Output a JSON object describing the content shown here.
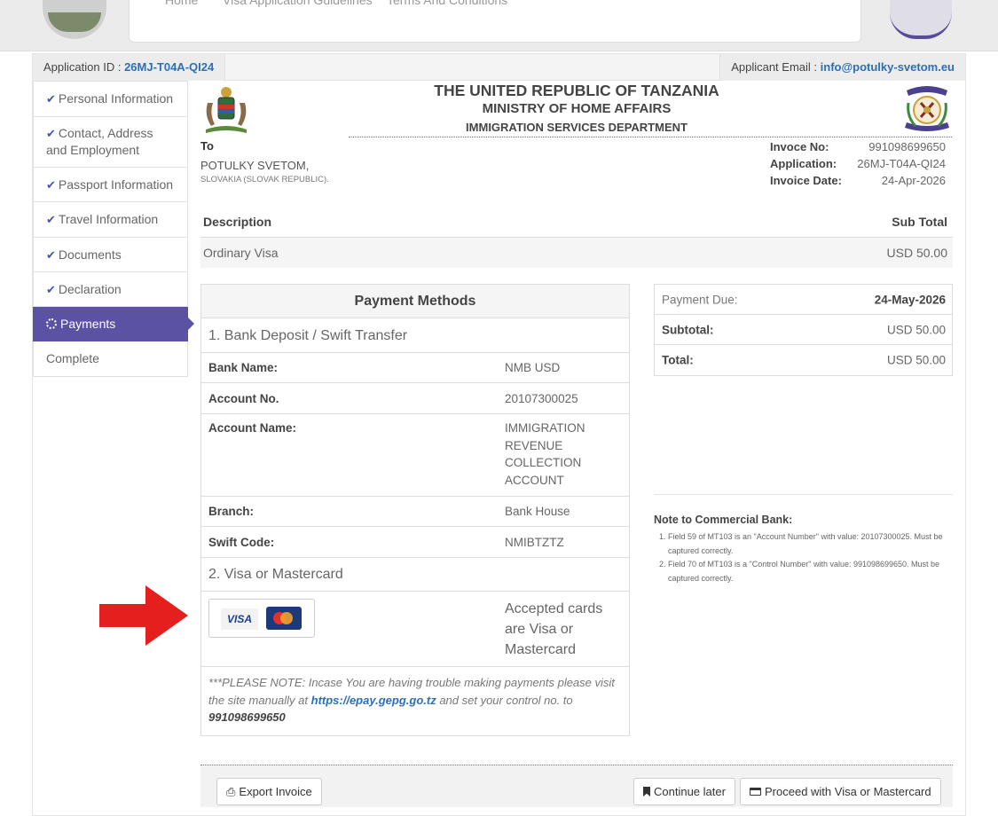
{
  "nav": {
    "links": [
      "Home",
      "Visa Application Guidelines",
      "Terms And Conditions"
    ]
  },
  "application": {
    "id_label": "Application ID :",
    "id_value": "26MJ-T04A-QI24",
    "email_label": "Applicant Email :",
    "email_value": "info@potulky-svetom.eu"
  },
  "sidebar": {
    "items": [
      {
        "label": "Personal Information",
        "done": true
      },
      {
        "label": "Contact, Address and Employment",
        "done": true
      },
      {
        "label": "Passport Information",
        "done": true
      },
      {
        "label": "Travel Information",
        "done": true
      },
      {
        "label": "Documents",
        "done": true
      },
      {
        "label": "Declaration",
        "done": true
      },
      {
        "label": "Payments",
        "active": true
      },
      {
        "label": "Complete",
        "done": false
      }
    ]
  },
  "invoice": {
    "title1": "THE UNITED REPUBLIC OF TANZANIA",
    "title2": "MINISTRY OF HOME AFFAIRS",
    "title3": "IMMIGRATION SERVICES DEPARTMENT",
    "to_label": "To",
    "to_name": "POTULKY SVETOM,",
    "to_country": "SLOVAKIA (SLOVAK REPUBLIC).",
    "invoice_no_label": "Invoce No:",
    "invoice_no_value": "991098699650",
    "application_label": "Application:",
    "application_value": "26MJ-T04A-QI24",
    "date_label": "Invoice Date:",
    "date_value": "24-Apr-2026"
  },
  "items_table": {
    "col_description": "Description",
    "col_subtotal": "Sub Total",
    "row_description": "Ordinary Visa",
    "row_subtotal": "USD 50.00"
  },
  "payment_methods": {
    "title": "Payment Methods",
    "section1": "1. Bank Deposit / Swift Transfer",
    "bank_name_label": "Bank Name:",
    "bank_name_value": "NMB USD",
    "account_no_label": "Account No.",
    "account_no_value": "20107300025",
    "account_name_label": "Account Name:",
    "account_name_lines": [
      "IMMIGRATION",
      "REVENUE",
      "COLLECTION",
      "ACCOUNT"
    ],
    "branch_label": "Branch:",
    "branch_value": "Bank House",
    "swift_label": "Swift Code:",
    "swift_value": "NMIBTZTZ",
    "section2": "2. Visa or Mastercard",
    "visa_text": "VISA",
    "accepted_lines": [
      "Accepted cards",
      "are Visa or",
      "Mastercard"
    ],
    "note_prefix": "***PLEASE NOTE: Incase You are having trouble making payments please visit the site manually at ",
    "note_link": "https://epay.gepg.go.tz",
    "note_middle": " and set your control no. to ",
    "note_control": "991098699650"
  },
  "summary": {
    "due_label": "Payment Due:",
    "due_value": "24-May-2026",
    "subtotal_label": "Subtotal:",
    "subtotal_value": "USD 50.00",
    "total_label": "Total:",
    "total_value": "USD 50.00"
  },
  "bank_note": {
    "title": "Note to Commercial Bank:",
    "items": [
      "Field 59 of MT103 is an \"Account Number\" with value: 20107300025. Must be captured correctly.",
      "Field 70 of MT103 is a \"Control Number\" with value: 991098699650. Must be captured correctly."
    ]
  },
  "buttons": {
    "export": "Export Invoice",
    "continue_later": "Continue later",
    "proceed": "Proceed with Visa or Mastercard"
  },
  "colors": {
    "accent": "#5b52a3",
    "link": "#2d6fb4",
    "arrow": "#e51e1e"
  }
}
